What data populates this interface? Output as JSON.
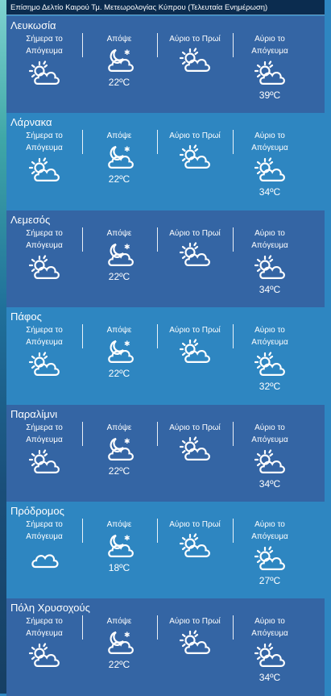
{
  "header": {
    "title": "Επίσημο Δελτίο Καιρού Τμ. Μετεωρολογίας Κύπρου (Τελευταία Ενημέρωση)"
  },
  "columns": {
    "today_afternoon": "Σήμερα το Απόγευμα",
    "tonight": "Απόψε",
    "tomorrow_morning": "Αύριο το Πρωί",
    "tomorrow_afternoon": "Αύριο το Απόγευμα"
  },
  "cities": [
    {
      "name": "Λευκωσία",
      "tonight_temp": "22ºC",
      "tomorrow_afternoon_temp": "39ºC",
      "icons": [
        "partly-cloudy-icon",
        "night-cloudy-icon",
        "partly-cloudy-icon",
        "partly-cloudy-icon"
      ]
    },
    {
      "name": "Λάρνακα",
      "tonight_temp": "22ºC",
      "tomorrow_afternoon_temp": "34ºC",
      "icons": [
        "partly-cloudy-icon",
        "night-cloudy-icon",
        "partly-cloudy-icon",
        "partly-cloudy-icon"
      ]
    },
    {
      "name": "Λεμεσός",
      "tonight_temp": "22ºC",
      "tomorrow_afternoon_temp": "34ºC",
      "icons": [
        "partly-cloudy-icon",
        "night-cloudy-icon",
        "partly-cloudy-icon",
        "partly-cloudy-icon"
      ]
    },
    {
      "name": "Πάφος",
      "tonight_temp": "22ºC",
      "tomorrow_afternoon_temp": "32ºC",
      "icons": [
        "partly-cloudy-icon",
        "night-cloudy-icon",
        "partly-cloudy-icon",
        "partly-cloudy-icon"
      ]
    },
    {
      "name": "Παραλίμνι",
      "tonight_temp": "22ºC",
      "tomorrow_afternoon_temp": "34ºC",
      "icons": [
        "partly-cloudy-icon",
        "night-cloudy-icon",
        "partly-cloudy-icon",
        "partly-cloudy-icon"
      ]
    },
    {
      "name": "Πρόδρομος",
      "tonight_temp": "18ºC",
      "tomorrow_afternoon_temp": "27ºC",
      "icons": [
        "cloud-icon",
        "night-cloudy-icon",
        "partly-cloudy-icon",
        "partly-cloudy-icon"
      ]
    },
    {
      "name": "Πόλη Χρυσοχούς",
      "tonight_temp": "22ºC",
      "tomorrow_afternoon_temp": "34ºC",
      "icons": [
        "partly-cloudy-icon",
        "night-cloudy-icon",
        "partly-cloudy-icon",
        "partly-cloudy-icon"
      ]
    }
  ],
  "colors": {
    "band_dark": "#3465a4",
    "band_light": "#2e86c1",
    "header_bg": "#0b2c4f"
  }
}
